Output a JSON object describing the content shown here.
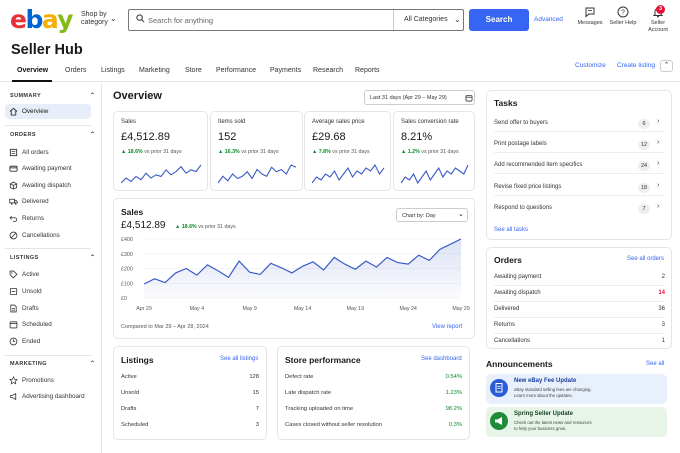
{
  "header": {
    "logo_letters": [
      "e",
      "b",
      "a",
      "y"
    ],
    "logo_colors": [
      "#e53238",
      "#0064d2",
      "#f5af02",
      "#86b817"
    ],
    "shop_by_line1": "Shop by",
    "shop_by_line2": "category",
    "search_placeholder": "Search for anything",
    "category_select": "All Categories",
    "search_button": "Search",
    "advanced": "Advanced",
    "messages": "Messages",
    "seller_help": "Seller Help",
    "account_line1": "Seller",
    "account_line2": "Account",
    "notif_count": "3",
    "accent": "#3665f3"
  },
  "page_title": "Seller Hub",
  "tabs": [
    "Overview",
    "Orders",
    "Listings",
    "Marketing",
    "Store",
    "Performance",
    "Payments",
    "Research",
    "Reports"
  ],
  "top_links": {
    "customize": "Customize",
    "create_listing": "Create listing"
  },
  "sidebar": {
    "summary": {
      "heading": "SUMMARY",
      "items": [
        "Overview"
      ]
    },
    "orders": {
      "heading": "ORDERS",
      "items": [
        "All orders",
        "Awaiting payment",
        "Awaiting dispatch",
        "Delivered",
        "Returns",
        "Cancellations"
      ]
    },
    "listings": {
      "heading": "LISTINGS",
      "items": [
        "Active",
        "Unsold",
        "Drafts",
        "Scheduled",
        "Ended"
      ]
    },
    "marketing": {
      "heading": "MARKETING",
      "items": [
        "Promotions",
        "Advertising dashboard"
      ]
    }
  },
  "overview": {
    "title": "Overview",
    "date_range": "Last 31 days (Apr 29 – May 29)"
  },
  "kpis": [
    {
      "label": "Sales",
      "value": "£4,512.89",
      "delta": "18.6%",
      "vs": "vs prior 31 days",
      "spark": [
        5,
        8,
        6,
        9,
        7,
        11,
        8,
        10,
        9,
        13,
        10,
        12,
        15,
        11,
        13,
        12,
        16
      ]
    },
    {
      "label": "Items sold",
      "value": "152",
      "delta": "16.3%",
      "vs": "vs prior 31 days",
      "spark": [
        6,
        9,
        7,
        10,
        8,
        9,
        11,
        8,
        12,
        10,
        9,
        13,
        11,
        12,
        10,
        14,
        13
      ]
    },
    {
      "label": "Average sales price",
      "value": "£29.68",
      "delta": "7.8%",
      "vs": "vs prior 31 days",
      "spark": [
        7,
        9,
        8,
        10,
        9,
        11,
        8,
        10,
        12,
        9,
        11,
        10,
        12,
        11,
        13,
        10,
        12
      ]
    },
    {
      "label": "Sales conversion rate",
      "value": "8.21%",
      "delta": "1.2%",
      "vs": "vs prior 31 days",
      "spark": [
        8,
        10,
        9,
        11,
        8,
        10,
        12,
        9,
        11,
        13,
        10,
        12,
        11,
        13,
        12,
        11,
        14
      ]
    }
  ],
  "sales_chart": {
    "title": "Sales",
    "value": "£4,512.89",
    "delta": "18.6%",
    "vs": "vs prior 31 days",
    "chart_by": "Chart by: Day",
    "compared": "Compared to Mar 29 – Apr 28, 2024",
    "view_report": "View report"
  },
  "chart_data": {
    "type": "area",
    "title": "Sales",
    "x": [
      "Apr 29",
      "Apr 30",
      "May 1",
      "May 2",
      "May 3",
      "May 4",
      "May 5",
      "May 6",
      "May 7",
      "May 8",
      "May 9",
      "May 10",
      "May 11",
      "May 12",
      "May 13",
      "May 14",
      "May 15",
      "May 16",
      "May 17",
      "May 18",
      "May 19",
      "May 20",
      "May 21",
      "May 22",
      "May 23",
      "May 24",
      "May 25",
      "May 26",
      "May 27",
      "May 28",
      "May 29"
    ],
    "x_tick_labels": [
      "Apr 29",
      "May 4",
      "May 9",
      "May 14",
      "May 19",
      "May 24",
      "May 29"
    ],
    "values": [
      95,
      130,
      105,
      170,
      200,
      155,
      225,
      185,
      140,
      250,
      175,
      160,
      235,
      205,
      170,
      215,
      245,
      190,
      275,
      230,
      195,
      250,
      210,
      275,
      240,
      230,
      290,
      255,
      330,
      365,
      400
    ],
    "ylim": [
      0,
      400
    ],
    "y_ticks": [
      "£0",
      "£100",
      "£200",
      "£300",
      "£400"
    ],
    "color": "#3a5bc7",
    "grid": true
  },
  "tasks": {
    "title": "Tasks",
    "items": [
      {
        "label": "Send offer to buyers",
        "count": "6"
      },
      {
        "label": "Print postage labels",
        "count": "12"
      },
      {
        "label": "Add recommended item specifics",
        "count": "24"
      },
      {
        "label": "Revise fixed price listings",
        "count": "18"
      },
      {
        "label": "Respond to questions",
        "count": "7"
      }
    ],
    "see_all": "See all tasks"
  },
  "orders_box": {
    "title": "Orders",
    "see_all": "See all orders",
    "rows": [
      {
        "label": "Awaiting payment",
        "value": "2"
      },
      {
        "label": "Awaiting dispatch",
        "value": "14"
      },
      {
        "label": "Delivered",
        "value": "36"
      },
      {
        "label": "Returns",
        "value": "3"
      },
      {
        "label": "Cancellations",
        "value": "1"
      }
    ]
  },
  "listings_box": {
    "title": "Listings",
    "see_all": "See all listings",
    "rows": [
      {
        "label": "Active",
        "value": "128"
      },
      {
        "label": "Unsold",
        "value": "15"
      },
      {
        "label": "Drafts",
        "value": "7"
      },
      {
        "label": "Scheduled",
        "value": "3"
      }
    ]
  },
  "performance": {
    "title": "Store performance",
    "see_dash": "See dashboard",
    "rows": [
      {
        "label": "Defect rate",
        "value": "0.54%"
      },
      {
        "label": "Late dispatch rate",
        "value": "1.23%"
      },
      {
        "label": "Tracking uploaded on time",
        "value": "98.2%"
      },
      {
        "label": "Cases closed without seller resolution",
        "value": "0.3%"
      }
    ]
  },
  "announcements": {
    "title": "Announcements",
    "see_all": "See all",
    "items": [
      {
        "title": "New eBay Fee Update",
        "desc_line1": "eBay standard selling fees are changing.",
        "desc_line2": "Learn more about the updates."
      },
      {
        "title": "Spring Seller Update",
        "desc_line1": "Check out the latest news and resources",
        "desc_line2": "to help your business grow."
      }
    ]
  }
}
